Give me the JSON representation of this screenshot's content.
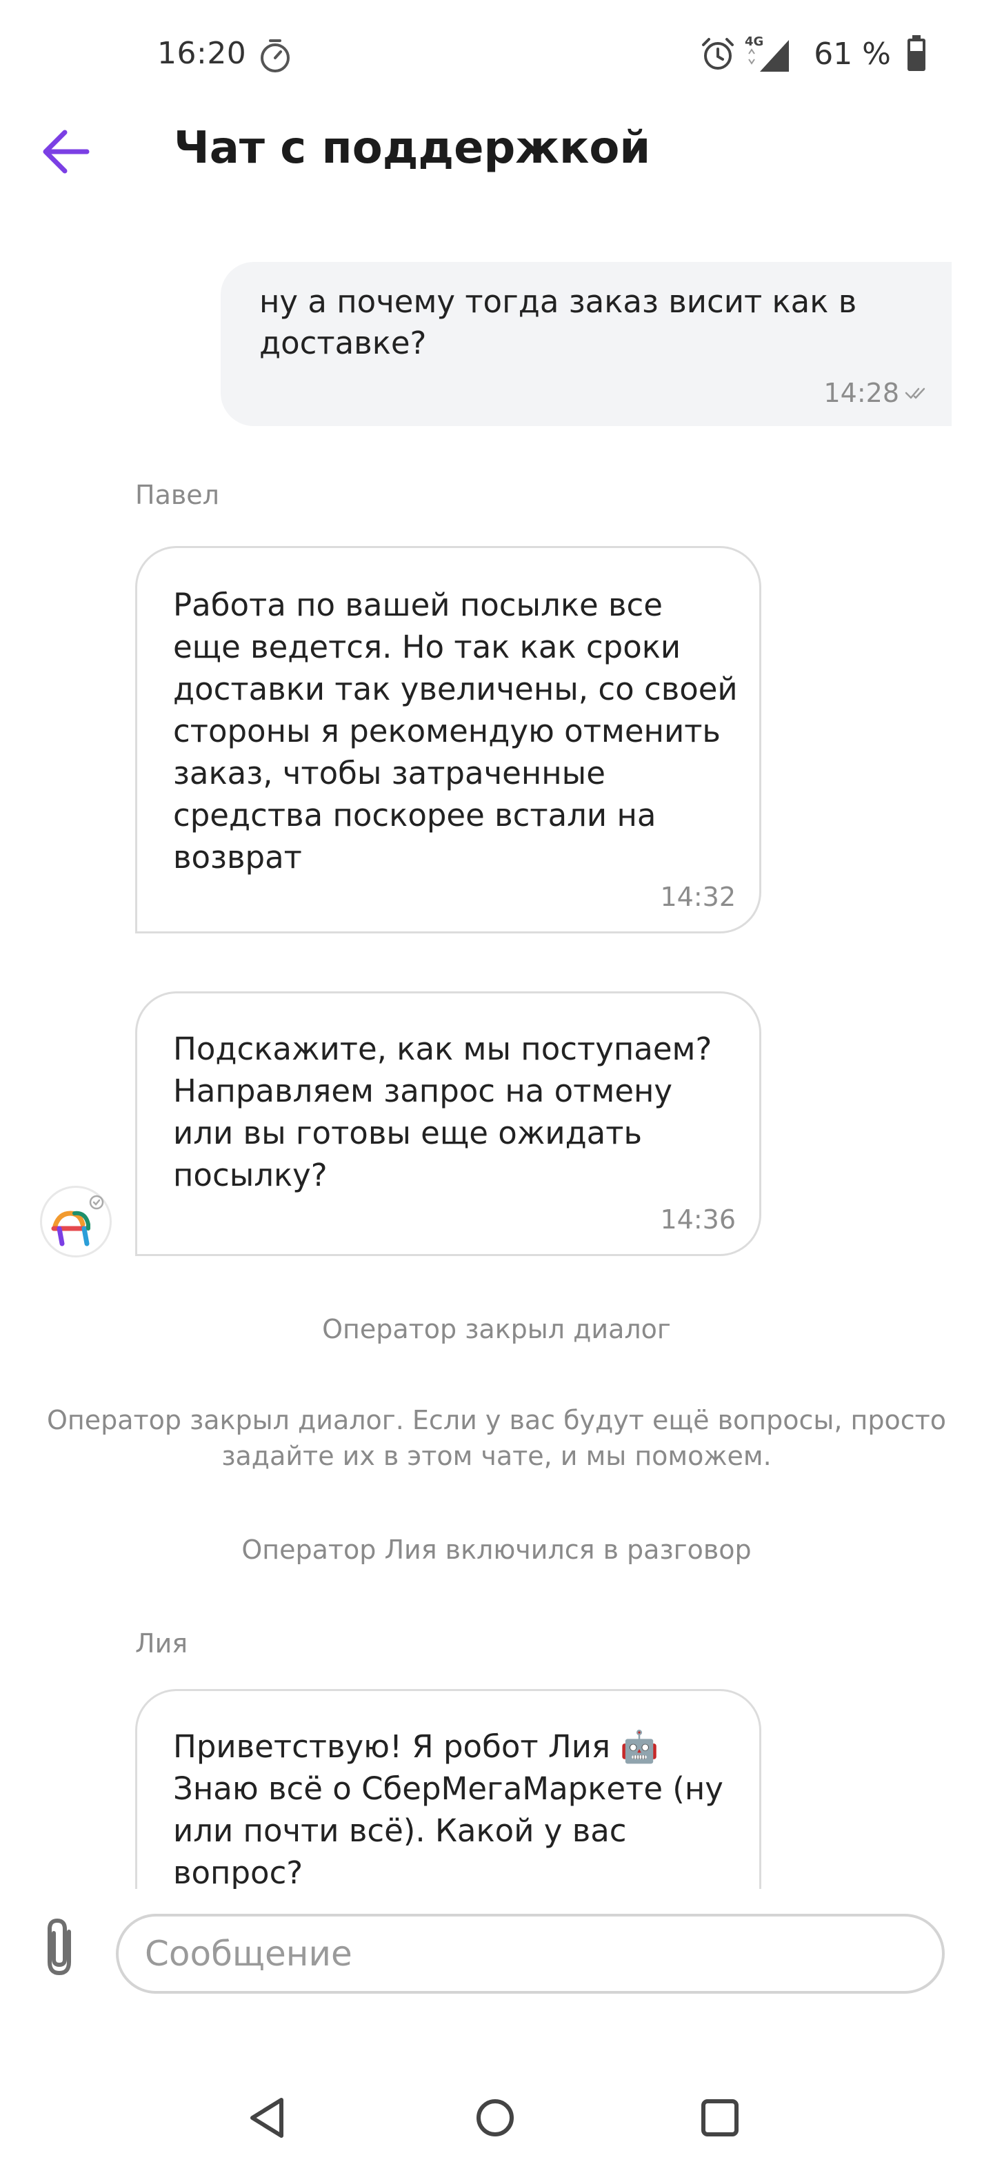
{
  "status_bar": {
    "time": "16:20",
    "network": "4G",
    "battery": "61 %",
    "icons": [
      "timer-icon",
      "alarm-icon",
      "signal-icon",
      "battery-icon"
    ]
  },
  "header": {
    "title": "Чат с поддержкой",
    "back_icon": "arrow-left-icon",
    "accent_color": "#7b3fe4"
  },
  "messages": [
    {
      "direction": "outgoing",
      "text": "ну а почему тогда заказ висит как в доставке?",
      "time": "14:28",
      "read": true
    },
    {
      "direction": "incoming",
      "sender": "Павел",
      "text": "Работа по вашей посылке все еще ведется. Но так как сроки доставки так увеличены, со своей стороны я рекомендую отменить заказ, чтобы затраченные средства поскорее встали на возврат",
      "time": "14:32"
    },
    {
      "direction": "incoming",
      "text": "Подскажите, как мы поступаем? Направляем запрос на отмену или вы готовы еще ожидать посылку?",
      "time": "14:36"
    },
    {
      "direction": "system",
      "text": "Оператор закрыл диалог"
    },
    {
      "direction": "system",
      "text": "Оператор закрыл диалог. Если у вас будут ещё вопросы, просто задайте их в этом чате, и мы поможем."
    },
    {
      "direction": "system",
      "text": "Оператор Лия включился в разговор"
    },
    {
      "direction": "incoming",
      "sender": "Лия",
      "text": "Приветствую! Я робот Лия 🤖 Знаю всё о СберМегаМаркете (ну или почти всё). Какой у вас вопрос?"
    }
  ],
  "composer": {
    "placeholder": "Сообщение",
    "attach_icon": "paperclip-icon"
  },
  "nav_bar": {
    "icons": [
      "nav-back-icon",
      "nav-home-icon",
      "nav-recents-icon"
    ]
  }
}
